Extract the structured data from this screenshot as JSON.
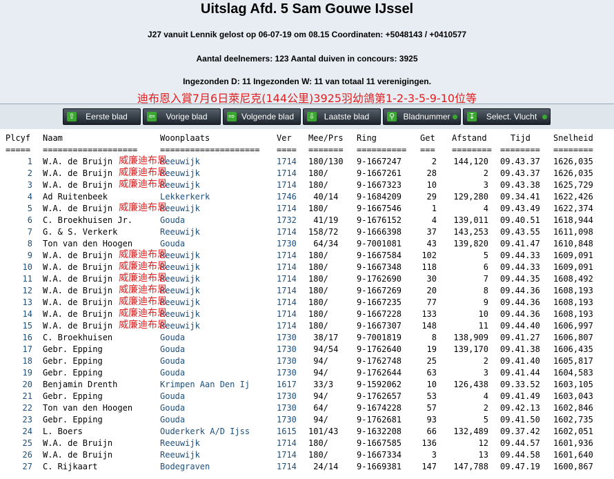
{
  "header": {
    "title": "Uitslag Afd. 5 Sam Gouwe IJssel",
    "line1": "J27 vanuit Lennik gelost op 06-07-19 om 08.15 Coordinaten: +5048143 / +0410577",
    "line2": "Aantal deelnemers: 123 Aantal duiven in concours: 3925",
    "line3": "Ingezonden D: 11 Ingezonden W: 11 van totaal 11 verenigingen.",
    "promo": "迪布恩入賞7月6日萊尼克(144公里)3925羽幼鴿第1-2-3-5-9-10位等"
  },
  "nav": {
    "first": "Eerste blad",
    "prev": "Vorige blad",
    "next": "Volgende blad",
    "last": "Laatste blad",
    "pagenum": "Bladnummer",
    "select": "Select. Vlucht"
  },
  "table": {
    "columns": [
      "Plcyf",
      "Naam",
      "Woonplaats",
      "Ver",
      "Mee/Prs",
      "Ring",
      "Get",
      "Afstand",
      "Tijd",
      "Snelheid"
    ],
    "underline": [
      "=====",
      "===================",
      "====================",
      "====",
      "=======",
      "==========",
      "===",
      "========",
      "========",
      "========"
    ],
    "marker": "威廉迪布恩",
    "rows": [
      {
        "plcyf": "1",
        "naam": "W.A. de Bruijn",
        "woonplaats": "Reeuwijk",
        "ver": "1714",
        "meeprs": "180/130",
        "ring": "9-1667247",
        "get": "2",
        "afstand": "144,120",
        "tijd": "09.43.37",
        "snelheid": "1626,035",
        "marked": true
      },
      {
        "plcyf": "2",
        "naam": "W.A. de Bruijn",
        "woonplaats": "Reeuwijk",
        "ver": "1714",
        "meeprs": "180/",
        "ring": "9-1667261",
        "get": "28",
        "afstand": "2",
        "tijd": "09.43.37",
        "snelheid": "1626,035",
        "marked": true
      },
      {
        "plcyf": "3",
        "naam": "W.A. de Bruijn",
        "woonplaats": "Reeuwijk",
        "ver": "1714",
        "meeprs": "180/",
        "ring": "9-1667323",
        "get": "10",
        "afstand": "3",
        "tijd": "09.43.38",
        "snelheid": "1625,729",
        "marked": true
      },
      {
        "plcyf": "4",
        "naam": "Ad Ruitenbeek",
        "woonplaats": "Lekkerkerk",
        "ver": "1746",
        "meeprs": "40/14",
        "ring": "9-1684209",
        "get": "29",
        "afstand": "129,280",
        "tijd": "09.34.41",
        "snelheid": "1622,426",
        "marked": false
      },
      {
        "plcyf": "5",
        "naam": "W.A. de Bruijn",
        "woonplaats": "Reeuwijk",
        "ver": "1714",
        "meeprs": "180/",
        "ring": "9-1667546",
        "get": "1",
        "afstand": "4",
        "tijd": "09.43.49",
        "snelheid": "1622,374",
        "marked": true
      },
      {
        "plcyf": "6",
        "naam": "C. Broekhuisen Jr.",
        "woonplaats": "Gouda",
        "ver": "1732",
        "meeprs": "41/19",
        "ring": "9-1676152",
        "get": "4",
        "afstand": "139,011",
        "tijd": "09.40.51",
        "snelheid": "1618,944",
        "marked": false
      },
      {
        "plcyf": "7",
        "naam": "G. & S. Verkerk",
        "woonplaats": "Reeuwijk",
        "ver": "1714",
        "meeprs": "158/72",
        "ring": "9-1666398",
        "get": "37",
        "afstand": "143,253",
        "tijd": "09.43.55",
        "snelheid": "1611,098",
        "marked": false
      },
      {
        "plcyf": "8",
        "naam": "Ton van den Hoogen",
        "woonplaats": "Gouda",
        "ver": "1730",
        "meeprs": "64/34",
        "ring": "9-7001081",
        "get": "43",
        "afstand": "139,820",
        "tijd": "09.41.47",
        "snelheid": "1610,848",
        "marked": false
      },
      {
        "plcyf": "9",
        "naam": "W.A. de Bruijn",
        "woonplaats": "Reeuwijk",
        "ver": "1714",
        "meeprs": "180/",
        "ring": "9-1667584",
        "get": "102",
        "afstand": "5",
        "tijd": "09.44.33",
        "snelheid": "1609,091",
        "marked": true
      },
      {
        "plcyf": "10",
        "naam": "W.A. de Bruijn",
        "woonplaats": "Reeuwijk",
        "ver": "1714",
        "meeprs": "180/",
        "ring": "9-1667348",
        "get": "118",
        "afstand": "6",
        "tijd": "09.44.33",
        "snelheid": "1609,091",
        "marked": true
      },
      {
        "plcyf": "11",
        "naam": "W.A. de Bruijn",
        "woonplaats": "Reeuwijk",
        "ver": "1714",
        "meeprs": "180/",
        "ring": "9-1762690",
        "get": "30",
        "afstand": "7",
        "tijd": "09.44.35",
        "snelheid": "1608,492",
        "marked": true
      },
      {
        "plcyf": "12",
        "naam": "W.A. de Bruijn",
        "woonplaats": "Reeuwijk",
        "ver": "1714",
        "meeprs": "180/",
        "ring": "9-1667269",
        "get": "20",
        "afstand": "8",
        "tijd": "09.44.36",
        "snelheid": "1608,193",
        "marked": true
      },
      {
        "plcyf": "13",
        "naam": "W.A. de Bruijn",
        "woonplaats": "Reeuwijk",
        "ver": "1714",
        "meeprs": "180/",
        "ring": "9-1667235",
        "get": "77",
        "afstand": "9",
        "tijd": "09.44.36",
        "snelheid": "1608,193",
        "marked": true
      },
      {
        "plcyf": "14",
        "naam": "W.A. de Bruijn",
        "woonplaats": "Reeuwijk",
        "ver": "1714",
        "meeprs": "180/",
        "ring": "9-1667228",
        "get": "133",
        "afstand": "10",
        "tijd": "09.44.36",
        "snelheid": "1608,193",
        "marked": true
      },
      {
        "plcyf": "15",
        "naam": "W.A. de Bruijn",
        "woonplaats": "Reeuwijk",
        "ver": "1714",
        "meeprs": "180/",
        "ring": "9-1667307",
        "get": "148",
        "afstand": "11",
        "tijd": "09.44.40",
        "snelheid": "1606,997",
        "marked": true
      },
      {
        "plcyf": "16",
        "naam": "C. Broekhuisen",
        "woonplaats": "Gouda",
        "ver": "1730",
        "meeprs": "38/17",
        "ring": "9-7001819",
        "get": "8",
        "afstand": "138,909",
        "tijd": "09.41.27",
        "snelheid": "1606,807",
        "marked": false
      },
      {
        "plcyf": "17",
        "naam": "Gebr. Epping",
        "woonplaats": "Gouda",
        "ver": "1730",
        "meeprs": "94/54",
        "ring": "9-1762640",
        "get": "19",
        "afstand": "139,170",
        "tijd": "09.41.38",
        "snelheid": "1606,435",
        "marked": false
      },
      {
        "plcyf": "18",
        "naam": "Gebr. Epping",
        "woonplaats": "Gouda",
        "ver": "1730",
        "meeprs": "94/",
        "ring": "9-1762748",
        "get": "25",
        "afstand": "2",
        "tijd": "09.41.40",
        "snelheid": "1605,817",
        "marked": false
      },
      {
        "plcyf": "19",
        "naam": "Gebr. Epping",
        "woonplaats": "Gouda",
        "ver": "1730",
        "meeprs": "94/",
        "ring": "9-1762644",
        "get": "63",
        "afstand": "3",
        "tijd": "09.41.44",
        "snelheid": "1604,583",
        "marked": false
      },
      {
        "plcyf": "20",
        "naam": "Benjamin Drenth",
        "woonplaats": "Krimpen Aan Den Ij",
        "ver": "1617",
        "meeprs": "33/3",
        "ring": "9-1592062",
        "get": "10",
        "afstand": "126,438",
        "tijd": "09.33.52",
        "snelheid": "1603,105",
        "marked": false
      },
      {
        "plcyf": "21",
        "naam": "Gebr. Epping",
        "woonplaats": "Gouda",
        "ver": "1730",
        "meeprs": "94/",
        "ring": "9-1762657",
        "get": "53",
        "afstand": "4",
        "tijd": "09.41.49",
        "snelheid": "1603,043",
        "marked": false
      },
      {
        "plcyf": "22",
        "naam": "Ton van den Hoogen",
        "woonplaats": "Gouda",
        "ver": "1730",
        "meeprs": "64/",
        "ring": "9-1674228",
        "get": "57",
        "afstand": "2",
        "tijd": "09.42.13",
        "snelheid": "1602,846",
        "marked": false
      },
      {
        "plcyf": "23",
        "naam": "Gebr. Epping",
        "woonplaats": "Gouda",
        "ver": "1730",
        "meeprs": "94/",
        "ring": "9-1762681",
        "get": "93",
        "afstand": "5",
        "tijd": "09.41.50",
        "snelheid": "1602,735",
        "marked": false
      },
      {
        "plcyf": "24",
        "naam": "L. Boers",
        "woonplaats": "Ouderkerk A/D Ijss",
        "ver": "1615",
        "meeprs": "101/43",
        "ring": "9-1632208",
        "get": "66",
        "afstand": "132,489",
        "tijd": "09.37.42",
        "snelheid": "1602,051",
        "marked": false
      },
      {
        "plcyf": "25",
        "naam": "W.A. de Bruijn",
        "woonplaats": "Reeuwijk",
        "ver": "1714",
        "meeprs": "180/",
        "ring": "9-1667585",
        "get": "136",
        "afstand": "12",
        "tijd": "09.44.57",
        "snelheid": "1601,936",
        "marked": false
      },
      {
        "plcyf": "26",
        "naam": "W.A. de Bruijn",
        "woonplaats": "Reeuwijk",
        "ver": "1714",
        "meeprs": "180/",
        "ring": "9-1667334",
        "get": "3",
        "afstand": "13",
        "tijd": "09.44.58",
        "snelheid": "1601,640",
        "marked": false
      },
      {
        "plcyf": "27",
        "naam": "C. Rijkaart",
        "woonplaats": "Bodegraven",
        "ver": "1714",
        "meeprs": "24/14",
        "ring": "9-1669381",
        "get": "147",
        "afstand": "147,788",
        "tijd": "09.47.19",
        "snelheid": "1600,867",
        "marked": false
      }
    ]
  },
  "colors": {
    "header_bg": "#e7edf3",
    "link_blue": "#1c4f7c",
    "promo_red": "#e02020",
    "button_dark": "#1c242c",
    "button_icon_green": "#3ca632"
  },
  "icons": [
    "arrow-up-icon",
    "arrow-left-icon",
    "arrow-right-icon",
    "arrow-down-icon",
    "magnifier-icon",
    "download-icon"
  ]
}
